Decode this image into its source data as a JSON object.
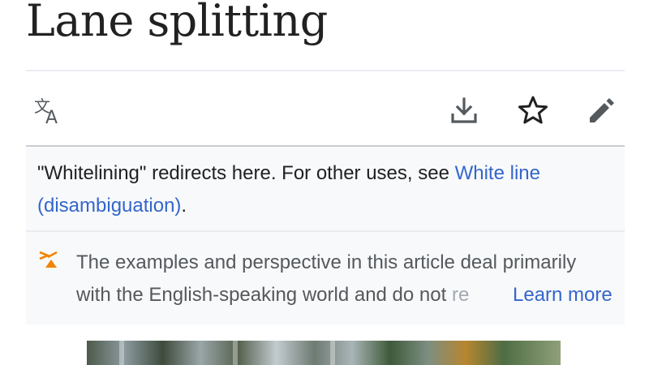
{
  "article": {
    "title": "Lane splitting"
  },
  "toolbar": {
    "language_icon": "translate-icon",
    "download_icon": "download-icon",
    "watch_icon": "star-outline-icon",
    "edit_icon": "pencil-icon"
  },
  "hatnote": {
    "text": "\"Whitelining\" redirects here. For other uses, see ",
    "link_label": "White line (disambiguation)",
    "trailing": "."
  },
  "notice": {
    "icon": "globe-issue-icon",
    "line1": "The examples and perspective in this article deal primarily",
    "line2_visible": "with the English-speaking world and do not ",
    "line2_faded": "re",
    "learn_more_label": "Learn more"
  },
  "colors": {
    "link": "#3366cc",
    "text": "#202122",
    "notice_icon": "#fc3"
  }
}
